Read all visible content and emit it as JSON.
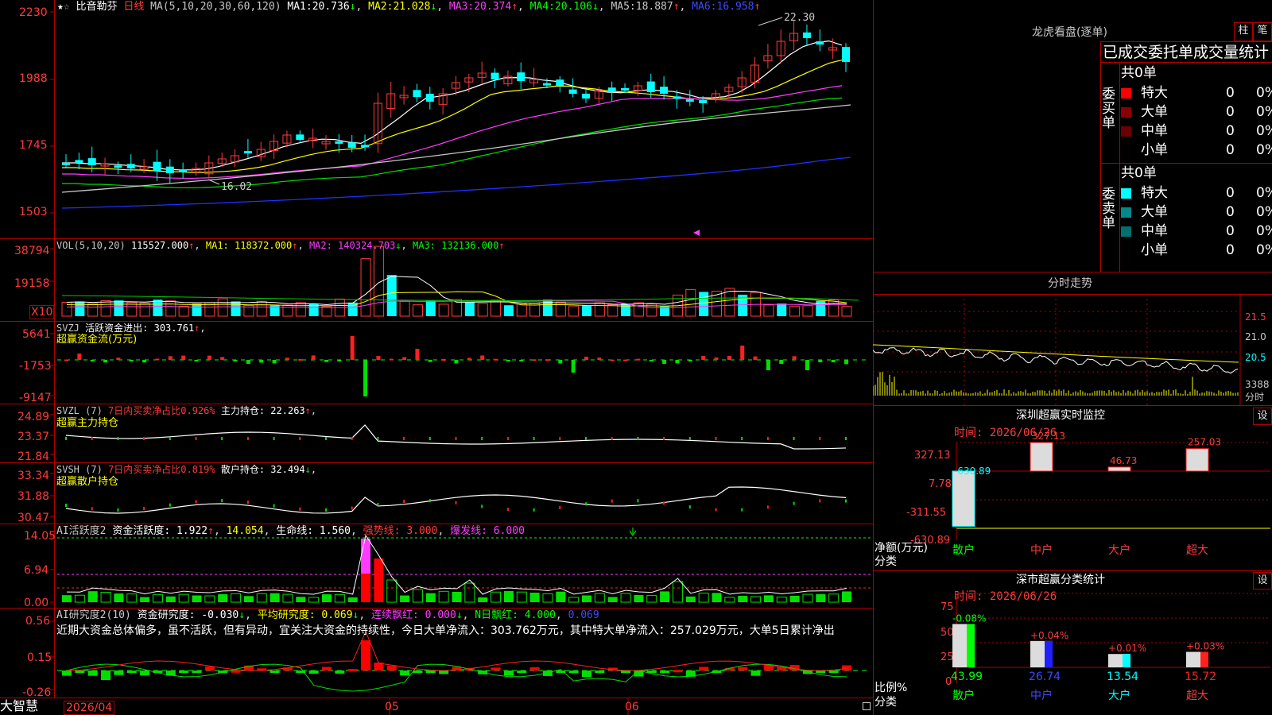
{
  "colors": {
    "up": "#ff3b3b",
    "down": "#00ffff",
    "border": "#b00000",
    "bg": "#000000",
    "ma1": "#ffffff",
    "ma2": "#ffff00",
    "ma3": "#ff3cff",
    "ma4": "#00e000",
    "ma5": "#c8c8c8",
    "ma6": "#2030ff"
  },
  "main": {
    "stock_name": "比音勒芬",
    "period": "日线",
    "ma_params": "MA(5,10,20,30,60,120)",
    "ma_values": [
      {
        "label": "MA1:",
        "value": "20.736",
        "arrow": "↓"
      },
      {
        "label": "MA2:",
        "value": "21.028",
        "arrow": "↓"
      },
      {
        "label": "MA3:",
        "value": "20.374",
        "arrow": "↑"
      },
      {
        "label": "MA4:",
        "value": "20.106",
        "arrow": "↓"
      },
      {
        "label": "MA5:",
        "value": "18.887",
        "arrow": "↑"
      },
      {
        "label": "MA6:",
        "value": "16.958",
        "arrow": "↑"
      }
    ],
    "y_labels": [
      "2230",
      "1988",
      "1745",
      "1503"
    ],
    "high_label": "22.30",
    "low_label": "16.02"
  },
  "vol": {
    "params": "VOL(5,10,20)",
    "value": "115527.000",
    "ma1": "MA1: 118372.000",
    "ma2": "MA2: 140324.703",
    "ma3": "MA3: 132136.000",
    "up_arrow": "↑",
    "down_arrow": "↓",
    "y_labels": [
      "38794",
      "19158"
    ],
    "unit": "X10"
  },
  "svzj": {
    "title": "SVZJ",
    "label": "活跃资金进出: 303.761",
    "arrow": "↑",
    "subtitle": "超赢资金流(万元)",
    "y_labels": [
      "5641",
      "-1753",
      "-9147"
    ]
  },
  "svzl": {
    "title": "SVZL (7)",
    "ratio_label": "7日内买卖净占比0.926%",
    "hold": "主力持仓: 22.263",
    "arrow": "↑",
    "subtitle": "超赢主力持仓",
    "y_labels": [
      "24.89",
      "23.37",
      "21.84"
    ]
  },
  "svsh": {
    "title": "SVSH (7)",
    "ratio_label": "7日内买卖净占比0.819%",
    "hold": "散户持仓: 32.494",
    "arrow": "↓",
    "subtitle": "超赢散户持仓",
    "y_labels": [
      "33.34",
      "31.88",
      "30.47"
    ]
  },
  "ai1": {
    "title": "AI活跃度2",
    "a": "资金活跃度: 1.922",
    "b": "14.054",
    "c": "生命线: 1.560",
    "d": "强势线: 3.000",
    "e": "爆发线: 6.000",
    "y_labels": [
      "14.05",
      "6.94",
      "0.00"
    ]
  },
  "ai2": {
    "title": "AI研究度2(10)",
    "a": "资金研究度: -0.030",
    "b": "平均研究度: 0.069",
    "c": "连续飘红: 0.000",
    "d": "N日飘红: 4.000",
    "e": "0.069",
    "comment": "近期大资金总体偏多，虽不活跃，但有异动，宜关注大资金的持续性，今日大单净流入：303.762万元，其中特大单净流入：257.029万元，大单5日累计净出",
    "y_labels": [
      "0.56",
      "0.15",
      "-0.26"
    ]
  },
  "bottom": {
    "brand": "大智慧",
    "date": "2026/04",
    "m5": "05",
    "m6": "06"
  },
  "dragon": {
    "title": "龙虎看盘(逐单)",
    "btn1": "柱",
    "btn2": "笔",
    "section": "已成交委托单成交量统计",
    "buy_label": "委买单",
    "sell_label": "委卖单",
    "total_buy": "共0单",
    "total_sell": "共0单",
    "buy_rows": [
      {
        "name": "特大",
        "count": "0",
        "pct": "0%",
        "color": "#ff0000"
      },
      {
        "name": "大单",
        "count": "0",
        "pct": "0%",
        "color": "#8a0000"
      },
      {
        "name": "中单",
        "count": "0",
        "pct": "0%",
        "color": "#6a0000"
      },
      {
        "name": "小单",
        "count": "0",
        "pct": "0%",
        "color": ""
      }
    ],
    "sell_rows": [
      {
        "name": "特大",
        "count": "0",
        "pct": "0%",
        "color": "#00ffff"
      },
      {
        "name": "大单",
        "count": "0",
        "pct": "0%",
        "color": "#008a8a"
      },
      {
        "name": "中单",
        "count": "0",
        "pct": "0%",
        "color": "#007070"
      },
      {
        "name": "小单",
        "count": "0",
        "pct": "0%",
        "color": ""
      }
    ]
  },
  "intraday": {
    "title": "分时走势",
    "y_labels": [
      "21.5",
      "21.0",
      "20.5",
      "3388"
    ],
    "unit": "分时"
  },
  "sz_monitor": {
    "title": "深圳超赢实时监控",
    "btn": "设",
    "date": "时间: 2026/06/26",
    "y_labels": [
      "327.13",
      "7.78",
      "-311.55",
      "-630.89"
    ],
    "ylabel": "净额(万元)",
    "xlabel": "分类",
    "bars": [
      {
        "name": "散户",
        "value": -630.89,
        "label": "-630.89"
      },
      {
        "name": "中户",
        "value": 327.13,
        "label": "327.13"
      },
      {
        "name": "大户",
        "value": 46.73,
        "label": "46.73"
      },
      {
        "name": "超大",
        "value": 257.03,
        "label": "257.03"
      }
    ]
  },
  "sz_stats": {
    "title": "深市超赢分类统计",
    "btn": "设",
    "date": "时间: 2026/06/26",
    "y_labels": [
      "75",
      "50",
      "25",
      "0"
    ],
    "ylabel": "比例%",
    "xlabel": "分类",
    "bars": [
      {
        "name": "散户",
        "value": 43.99,
        "label": "43.99",
        "chg": "-0.08%",
        "color": "#00ff00"
      },
      {
        "name": "中户",
        "value": 26.74,
        "label": "26.74",
        "chg": "+0.04%",
        "color": "#2020ff"
      },
      {
        "name": "大户",
        "value": 13.54,
        "label": "13.54",
        "chg": "+0.01%",
        "color": "#00ffff"
      },
      {
        "name": "超大",
        "value": 15.72,
        "label": "15.72",
        "chg": "+0.03%",
        "color": "#ff2020"
      }
    ]
  }
}
